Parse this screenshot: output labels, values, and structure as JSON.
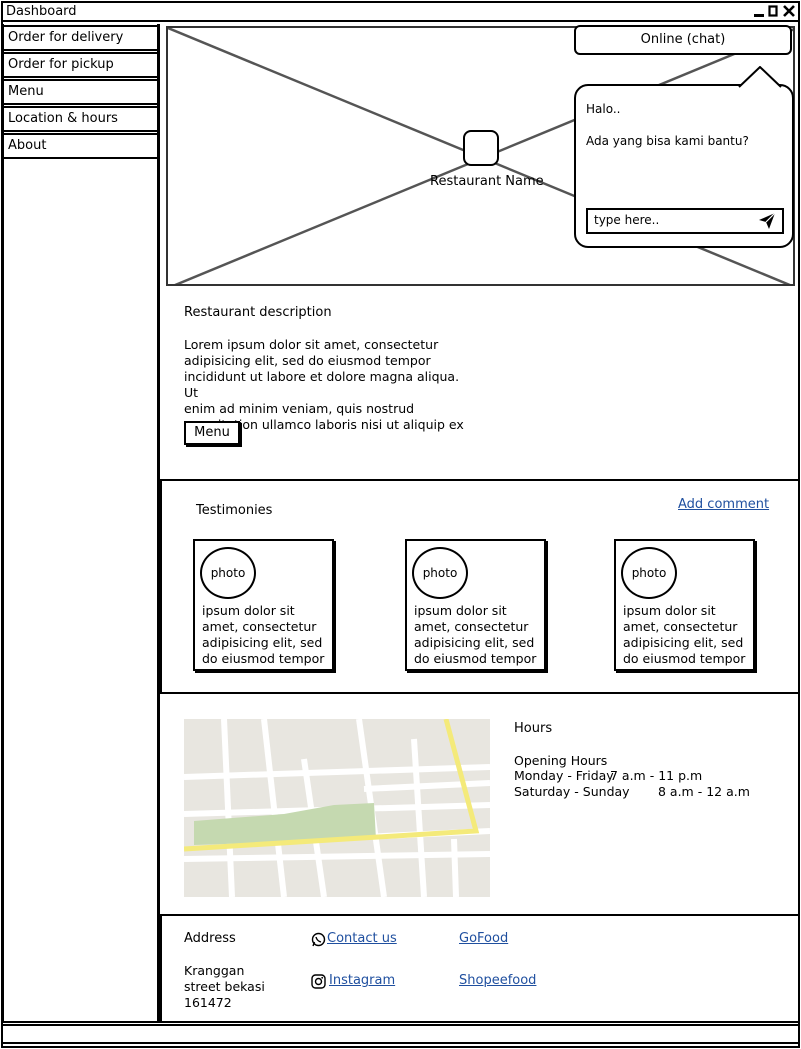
{
  "window": {
    "title": "Dashboard"
  },
  "sidebar": {
    "items": [
      {
        "label": "Order for delivery"
      },
      {
        "label": "Order for pickup"
      },
      {
        "label": "Menu"
      },
      {
        "label": "Location & hours"
      },
      {
        "label": "About"
      }
    ]
  },
  "hero": {
    "restaurant_name": "Restaurant Name"
  },
  "chat": {
    "button_label": "Online (chat)",
    "greeting": "Halo..",
    "question": "Ada yang bisa kami bantu?",
    "input_value": "type here.."
  },
  "description": {
    "title": "Restaurant description",
    "lines": [
      "Lorem ipsum dolor sit amet, consectetur",
      "adipisicing elit, sed do eiusmod tempor",
      "incididunt ut labore et dolore magna aliqua. Ut",
      "enim ad minim veniam, quis nostrud",
      "exercitation ullamco laboris nisi ut aliquip ex"
    ],
    "menu_button": "Menu"
  },
  "testimonies": {
    "title": "Testimonies",
    "add_comment": "Add comment",
    "cards": [
      {
        "photo": "photo",
        "lines": [
          " ipsum dolor sit",
          "amet, consectetur",
          "adipisicing elit, sed",
          "do eiusmod tempor"
        ]
      },
      {
        "photo": "photo",
        "lines": [
          " ipsum dolor sit",
          "amet, consectetur",
          "adipisicing elit, sed",
          "do eiusmod tempor"
        ]
      },
      {
        "photo": "photo",
        "lines": [
          " ipsum dolor sit",
          "amet, consectetur",
          "adipisicing elit, sed",
          "do eiusmod tempor"
        ]
      }
    ]
  },
  "hours": {
    "title": "Hours",
    "subtitle": "Opening Hours",
    "rows": [
      {
        "days": "Monday - Friday",
        "time": "7 a.m - 11 p.m"
      },
      {
        "days": "Saturday - Sunday",
        "time": "8 a.m - 12 a.m"
      }
    ]
  },
  "footer": {
    "address_title": "Address",
    "address_lines": [
      "Kranggan",
      "street bekasi",
      "161472"
    ],
    "contact_label": "Contact us",
    "instagram_label": "Instagram",
    "gofood_label": "GoFood",
    "shopeefood_label": "Shopeefood"
  },
  "icons": {
    "minimize": "minimize-icon",
    "maximize": "maximize-icon",
    "close": "close-icon",
    "send": "send-icon",
    "whatsapp": "whatsapp-icon",
    "instagram": "instagram-icon"
  },
  "colors": {
    "link": "#1f4f9f",
    "map_road_major": "#f4ea7a",
    "map_park": "#c5d9b0"
  }
}
